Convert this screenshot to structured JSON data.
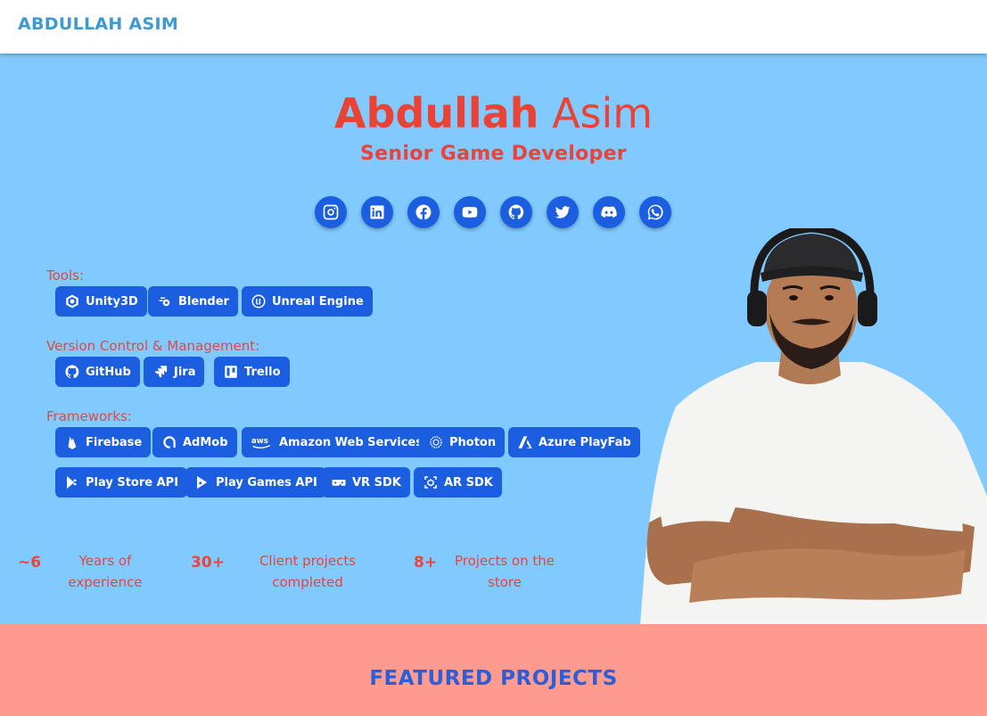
{
  "nav": {
    "brand": "ABDULLAH ASIM"
  },
  "hero": {
    "first_name": "Abdullah",
    "last_name": "Asim",
    "role": "Senior Game Developer",
    "socials": [
      {
        "icon": "instagram-icon"
      },
      {
        "icon": "linkedin-icon"
      },
      {
        "icon": "facebook-icon"
      },
      {
        "icon": "youtube-icon"
      },
      {
        "icon": "github-icon"
      },
      {
        "icon": "twitter-icon"
      },
      {
        "icon": "discord-icon"
      },
      {
        "icon": "whatsapp-icon"
      }
    ],
    "groups": {
      "tools": {
        "label": "Tools:",
        "items": [
          "Unity3D",
          "Blender",
          "Unreal Engine"
        ]
      },
      "version_control": {
        "label": "Version Control & Management:",
        "items": [
          "GitHub",
          "Jira",
          "Trello"
        ]
      },
      "frameworks": {
        "label": "Frameworks:",
        "items": [
          "Firebase",
          "AdMob",
          "Amazon Web Services",
          "Photon",
          "Azure PlayFab",
          "Play Store API",
          "Play Games API",
          "VR SDK",
          "AR SDK"
        ]
      }
    },
    "stats": [
      {
        "value": "~6",
        "line1": "Years of",
        "line2": "experience"
      },
      {
        "value": "30+",
        "line1": "Client projects",
        "line2": "completed"
      },
      {
        "value": "8+",
        "line1": "Projects on the",
        "line2": "store"
      }
    ]
  },
  "featured": {
    "title": "FEATURED PROJECTS"
  },
  "colors": {
    "brand": "#3d9ad1",
    "hero_bg": "#80caff",
    "accent_red": "#ea4335",
    "chip_blue": "#1b5fe0",
    "featured_bg": "#ff9a8e",
    "featured_title": "#2b5fd9"
  }
}
